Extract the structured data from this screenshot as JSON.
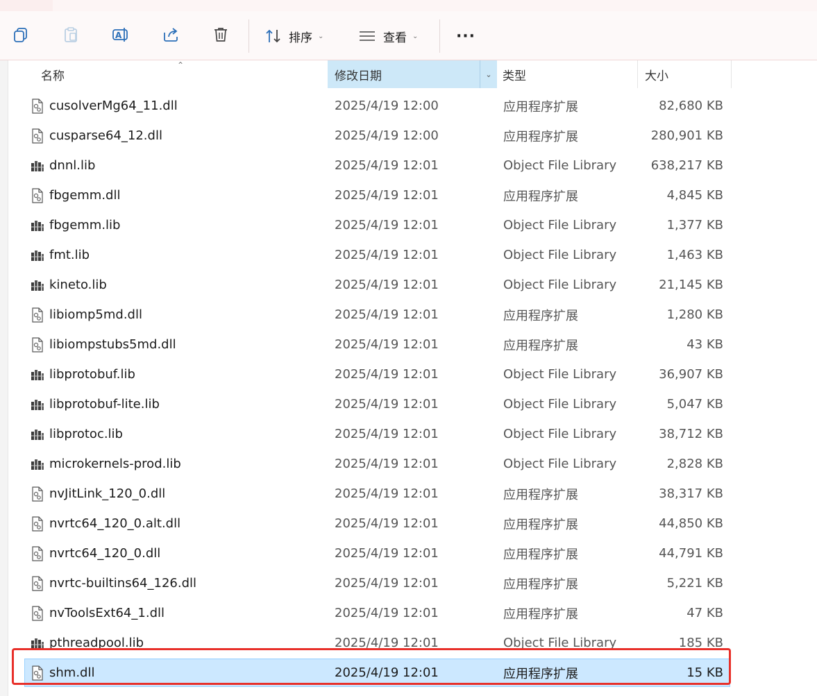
{
  "toolbar": {
    "sort_label": "排序",
    "view_label": "查看",
    "more_label": "···"
  },
  "columns": {
    "name": "名称",
    "date_modified": "修改日期",
    "type": "类型",
    "size": "大小"
  },
  "files": [
    {
      "icon": "dll-file-icon",
      "name": "cusolverMg64_11.dll",
      "date": "2025/4/19 12:00",
      "type": "应用程序扩展",
      "size": "82,680 KB"
    },
    {
      "icon": "dll-file-icon",
      "name": "cusparse64_12.dll",
      "date": "2025/4/19 12:00",
      "type": "应用程序扩展",
      "size": "280,901 KB"
    },
    {
      "icon": "lib-file-icon",
      "name": "dnnl.lib",
      "date": "2025/4/19 12:01",
      "type": "Object File Library",
      "size": "638,217 KB"
    },
    {
      "icon": "dll-file-icon",
      "name": "fbgemm.dll",
      "date": "2025/4/19 12:01",
      "type": "应用程序扩展",
      "size": "4,845 KB"
    },
    {
      "icon": "lib-file-icon",
      "name": "fbgemm.lib",
      "date": "2025/4/19 12:01",
      "type": "Object File Library",
      "size": "1,377 KB"
    },
    {
      "icon": "lib-file-icon",
      "name": "fmt.lib",
      "date": "2025/4/19 12:01",
      "type": "Object File Library",
      "size": "1,463 KB"
    },
    {
      "icon": "lib-file-icon",
      "name": "kineto.lib",
      "date": "2025/4/19 12:01",
      "type": "Object File Library",
      "size": "21,145 KB"
    },
    {
      "icon": "dll-file-icon",
      "name": "libiomp5md.dll",
      "date": "2025/4/19 12:01",
      "type": "应用程序扩展",
      "size": "1,280 KB"
    },
    {
      "icon": "dll-file-icon",
      "name": "libiompstubs5md.dll",
      "date": "2025/4/19 12:01",
      "type": "应用程序扩展",
      "size": "43 KB"
    },
    {
      "icon": "lib-file-icon",
      "name": "libprotobuf.lib",
      "date": "2025/4/19 12:01",
      "type": "Object File Library",
      "size": "36,907 KB"
    },
    {
      "icon": "lib-file-icon",
      "name": "libprotobuf-lite.lib",
      "date": "2025/4/19 12:01",
      "type": "Object File Library",
      "size": "5,047 KB"
    },
    {
      "icon": "lib-file-icon",
      "name": "libprotoc.lib",
      "date": "2025/4/19 12:01",
      "type": "Object File Library",
      "size": "38,712 KB"
    },
    {
      "icon": "lib-file-icon",
      "name": "microkernels-prod.lib",
      "date": "2025/4/19 12:01",
      "type": "Object File Library",
      "size": "2,828 KB"
    },
    {
      "icon": "dll-file-icon",
      "name": "nvJitLink_120_0.dll",
      "date": "2025/4/19 12:01",
      "type": "应用程序扩展",
      "size": "38,317 KB"
    },
    {
      "icon": "dll-file-icon",
      "name": "nvrtc64_120_0.alt.dll",
      "date": "2025/4/19 12:01",
      "type": "应用程序扩展",
      "size": "44,850 KB"
    },
    {
      "icon": "dll-file-icon",
      "name": "nvrtc64_120_0.dll",
      "date": "2025/4/19 12:01",
      "type": "应用程序扩展",
      "size": "44,791 KB"
    },
    {
      "icon": "dll-file-icon",
      "name": "nvrtc-builtins64_126.dll",
      "date": "2025/4/19 12:01",
      "type": "应用程序扩展",
      "size": "5,221 KB"
    },
    {
      "icon": "dll-file-icon",
      "name": "nvToolsExt64_1.dll",
      "date": "2025/4/19 12:01",
      "type": "应用程序扩展",
      "size": "47 KB"
    },
    {
      "icon": "lib-file-icon",
      "name": "pthreadpool.lib",
      "date": "2025/4/19 12:01",
      "type": "Object File Library",
      "size": "185 KB"
    },
    {
      "icon": "dll-file-icon",
      "name": "shm.dll",
      "date": "2025/4/19 12:01",
      "type": "应用程序扩展",
      "size": "15 KB",
      "selected": true
    }
  ],
  "colors": {
    "selection_fill": "#cce8ff",
    "selection_border": "#99d1ff",
    "highlight_box": "#e8302a",
    "sorted_header": "#cde8f8"
  }
}
